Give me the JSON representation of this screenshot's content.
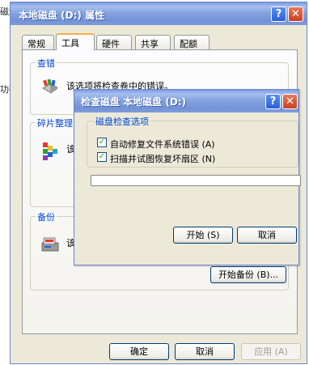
{
  "background_fragments": {
    "top": "磁盘",
    "middle": "功磁"
  },
  "properties_dialog": {
    "title": "本地磁盘 (D:) 属性",
    "help_glyph": "?",
    "close_glyph": "✕",
    "tabs": [
      {
        "label": "常规"
      },
      {
        "label": "工具",
        "active": true
      },
      {
        "label": "硬件"
      },
      {
        "label": "共享"
      },
      {
        "label": "配额"
      }
    ],
    "groups": {
      "error_check": {
        "label": "查错",
        "text": "该选项将检查卷中的错误。"
      },
      "defrag": {
        "label": "碎片整理",
        "text": "该"
      },
      "backup": {
        "label": "备份",
        "text": "该",
        "button": "开始备份 (B)..."
      }
    },
    "buttons": {
      "ok": "确定",
      "cancel": "取消",
      "apply": "应用 (A)"
    }
  },
  "check_disk_dialog": {
    "title": "检查磁盘 本地磁盘 (D:)",
    "help_glyph": "?",
    "close_glyph": "✕",
    "group_label": "磁盘检查选项",
    "options": [
      {
        "label": "自动修复文件系统错误 (A)",
        "checked": true
      },
      {
        "label": "扫描并试图恢复坏扇区 (N)",
        "checked": true
      }
    ],
    "progress_value": 0,
    "buttons": {
      "start": "开始 (S)",
      "cancel": "取消"
    }
  },
  "colors": {
    "title_bar": "#7a9ce3",
    "group_label": "#0046d5",
    "tab_active_accent": "#f4b042",
    "close_red": "#c8401f"
  }
}
